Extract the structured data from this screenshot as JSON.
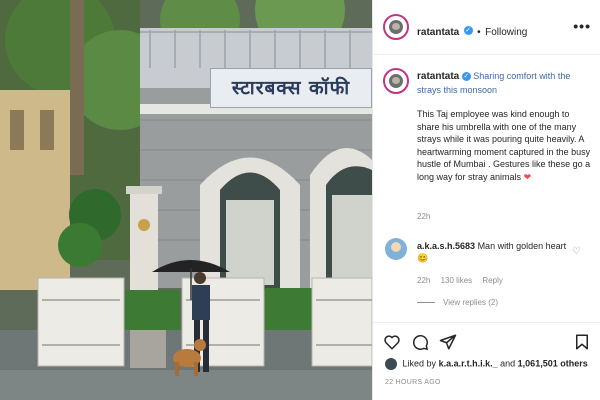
{
  "header": {
    "username": "ratantata",
    "separator": "•",
    "follow_status": "Following",
    "more_label": "•••"
  },
  "photo": {
    "sign_text": "स्टारबक्स कॉफी"
  },
  "caption": {
    "username": "ratantata",
    "headline": "Sharing comfort with the strays this monsoon",
    "body": "This Taj employee was kind enough to share his umbrella with one of the many strays while it was pouring quite heavily. A heartwarming moment captured in the busy hustle of Mumbai . Gestures like these go a long way for stray animals",
    "time": "22h"
  },
  "comment": {
    "username": "a.k.a.s.h.5683",
    "text": "Man with golden heart",
    "time": "22h",
    "likes": "130 likes",
    "reply": "Reply",
    "view_replies": "View replies (2)"
  },
  "likes": {
    "prefix": "Liked by",
    "user": "k.a.a.r.t.h.i.k._",
    "conj": "and",
    "others": "1,061,501 others"
  },
  "post_time": "22 HOURS AGO",
  "colors": {
    "accent_blue": "#3897f0",
    "heart_red": "#ed4956",
    "ring": "#c13584"
  },
  "icons": [
    "heart-icon",
    "comment-icon",
    "share-icon",
    "bookmark-icon",
    "verified-icon",
    "more-options-icon"
  ]
}
